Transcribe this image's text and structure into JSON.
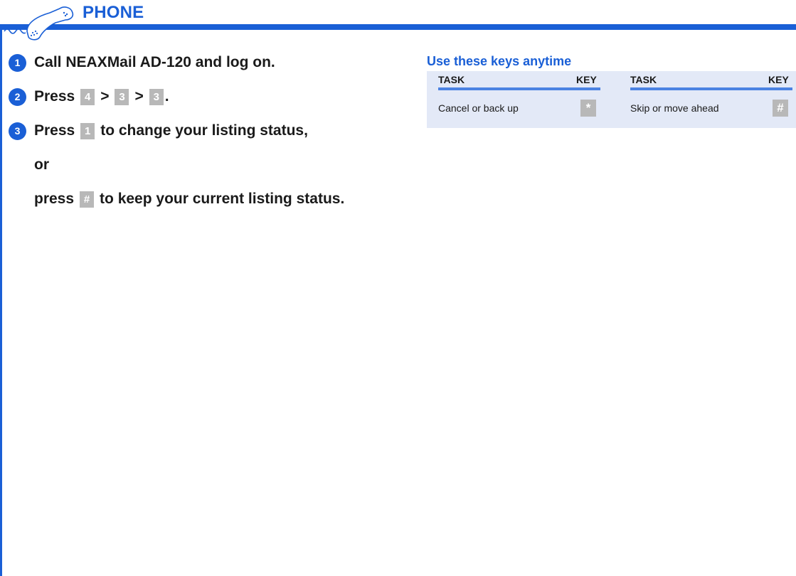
{
  "header": {
    "title": "PHONE",
    "icon": "phone-handset-icon",
    "accent": "#1a5fd6"
  },
  "steps": [
    {
      "number": "1",
      "parts": {
        "text": "Call NEAXMail AD-120 and log on."
      }
    },
    {
      "number": "2",
      "parts": {
        "prefix": "Press",
        "key1": "4",
        "sep1": ">",
        "key2": "3",
        "sep2": ">",
        "key3": "3",
        "suffix": "."
      }
    },
    {
      "number": "3",
      "parts": {
        "prefix": "Press",
        "key": "1",
        "suffix": "to change your listing status,"
      },
      "or": "or",
      "alt": {
        "prefix": "press",
        "key": "#",
        "suffix": "to keep your current listing status."
      }
    }
  ],
  "keys_panel": {
    "title": "Use these keys anytime",
    "headers": {
      "task": "TASK",
      "key": "KEY"
    },
    "rows": [
      {
        "task": "Cancel or back up",
        "key": "*"
      },
      {
        "task": "Skip or move ahead",
        "key": "#"
      }
    ]
  }
}
